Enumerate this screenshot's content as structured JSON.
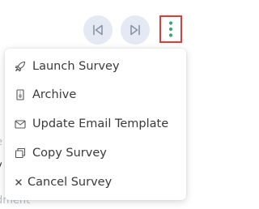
{
  "background": {
    "partial_text_1": "e",
    "partial_text_2": "y",
    "partial_text_3": "dment"
  },
  "toolbar": {
    "first_icon": "skip-previous-icon",
    "last_icon": "skip-next-icon",
    "more_icon": "vertical-dots-icon",
    "highlight_color": "#e53935"
  },
  "menu": {
    "items": [
      {
        "label": "Launch Survey",
        "icon": "rocket-icon"
      },
      {
        "label": "Archive",
        "icon": "archive-file-icon"
      },
      {
        "label": "Update Email Template",
        "icon": "envelope-icon"
      },
      {
        "label": "Copy Survey",
        "icon": "copy-icon"
      },
      {
        "label": "Cancel Survey",
        "icon": "close-icon"
      }
    ]
  }
}
